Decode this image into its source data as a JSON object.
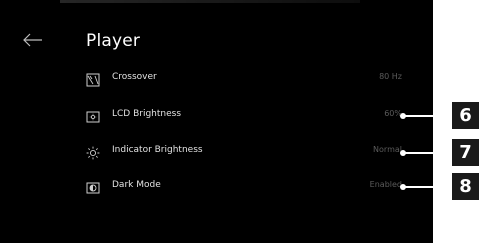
{
  "screen": {
    "title": "Player",
    "back_icon": "arrow-left-icon"
  },
  "settings": [
    {
      "label": "Crossover",
      "value": "80 Hz",
      "icon": "crossover-icon"
    },
    {
      "label": "LCD Brightness",
      "value": "60%",
      "icon": "lcd-brightness-icon"
    },
    {
      "label": "Indicator Brightness",
      "value": "Normal",
      "icon": "sun-icon"
    },
    {
      "label": "Dark Mode",
      "value": "Enabled",
      "icon": "contrast-icon"
    }
  ],
  "callouts": [
    {
      "number": "6"
    },
    {
      "number": "7"
    },
    {
      "number": "8"
    }
  ],
  "colors": {
    "screen_bg": "#000000",
    "label_text": "#e2e2e2",
    "value_text": "#5b5b5b",
    "badge_bg": "#1a1a1a",
    "badge_text": "#ffffff"
  }
}
